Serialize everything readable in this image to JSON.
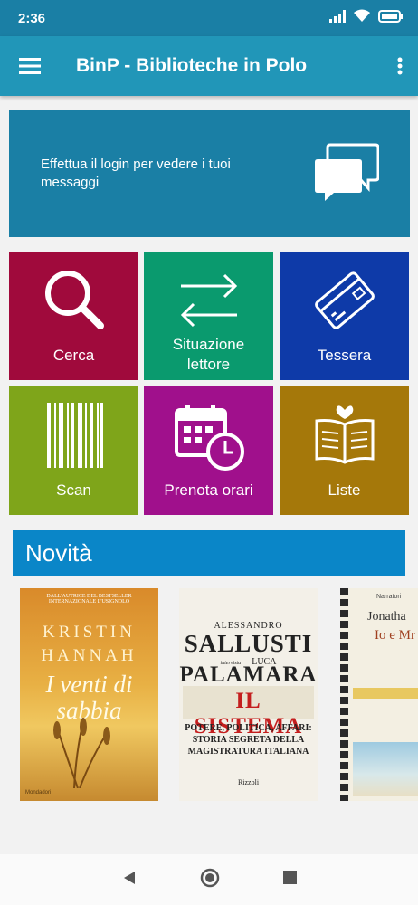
{
  "status_bar": {
    "time": "2:36"
  },
  "app_bar": {
    "title": "BinP - Biblioteche in Polo"
  },
  "login_banner": {
    "text": "Effettua il login per vedere i tuoi messaggi"
  },
  "tiles": [
    {
      "label": "Cerca",
      "color": "#a00a3c"
    },
    {
      "label": "Situazione lettore",
      "color": "#0a9a6e"
    },
    {
      "label": "Tessera",
      "color": "#0e3aa8"
    },
    {
      "label": "Scan",
      "color": "#7fa51a"
    },
    {
      "label": "Prenota orari",
      "color": "#a0108c"
    },
    {
      "label": "Liste",
      "color": "#a5780a"
    }
  ],
  "novita": {
    "title": "Novità"
  },
  "books": [
    {
      "top_text": "Dall'autrice del bestseller internazionale L'Usignolo",
      "author": "KRISTIN HANNAH",
      "title": "I venti di sabbia",
      "publisher": "Mondadori"
    },
    {
      "author_first": "ALESSANDRO",
      "author_last": "SALLUSTI",
      "intervista": "intervista",
      "co_first": "LUCA",
      "co_last": "PALAMARA",
      "title": "IL SISTEMA",
      "subtitle": "POTERE, POLITICA, AFFARI: STORIA SEGRETA DELLA MAGISTRATURA ITALIANA",
      "publisher": "Rizzoli"
    },
    {
      "series": "Narratori",
      "author": "Jonatha",
      "title": "Io e Mr"
    }
  ],
  "colors": {
    "primary": "#2196b8",
    "primary_dark": "#1a7fa5",
    "novita": "#0a86c8"
  }
}
